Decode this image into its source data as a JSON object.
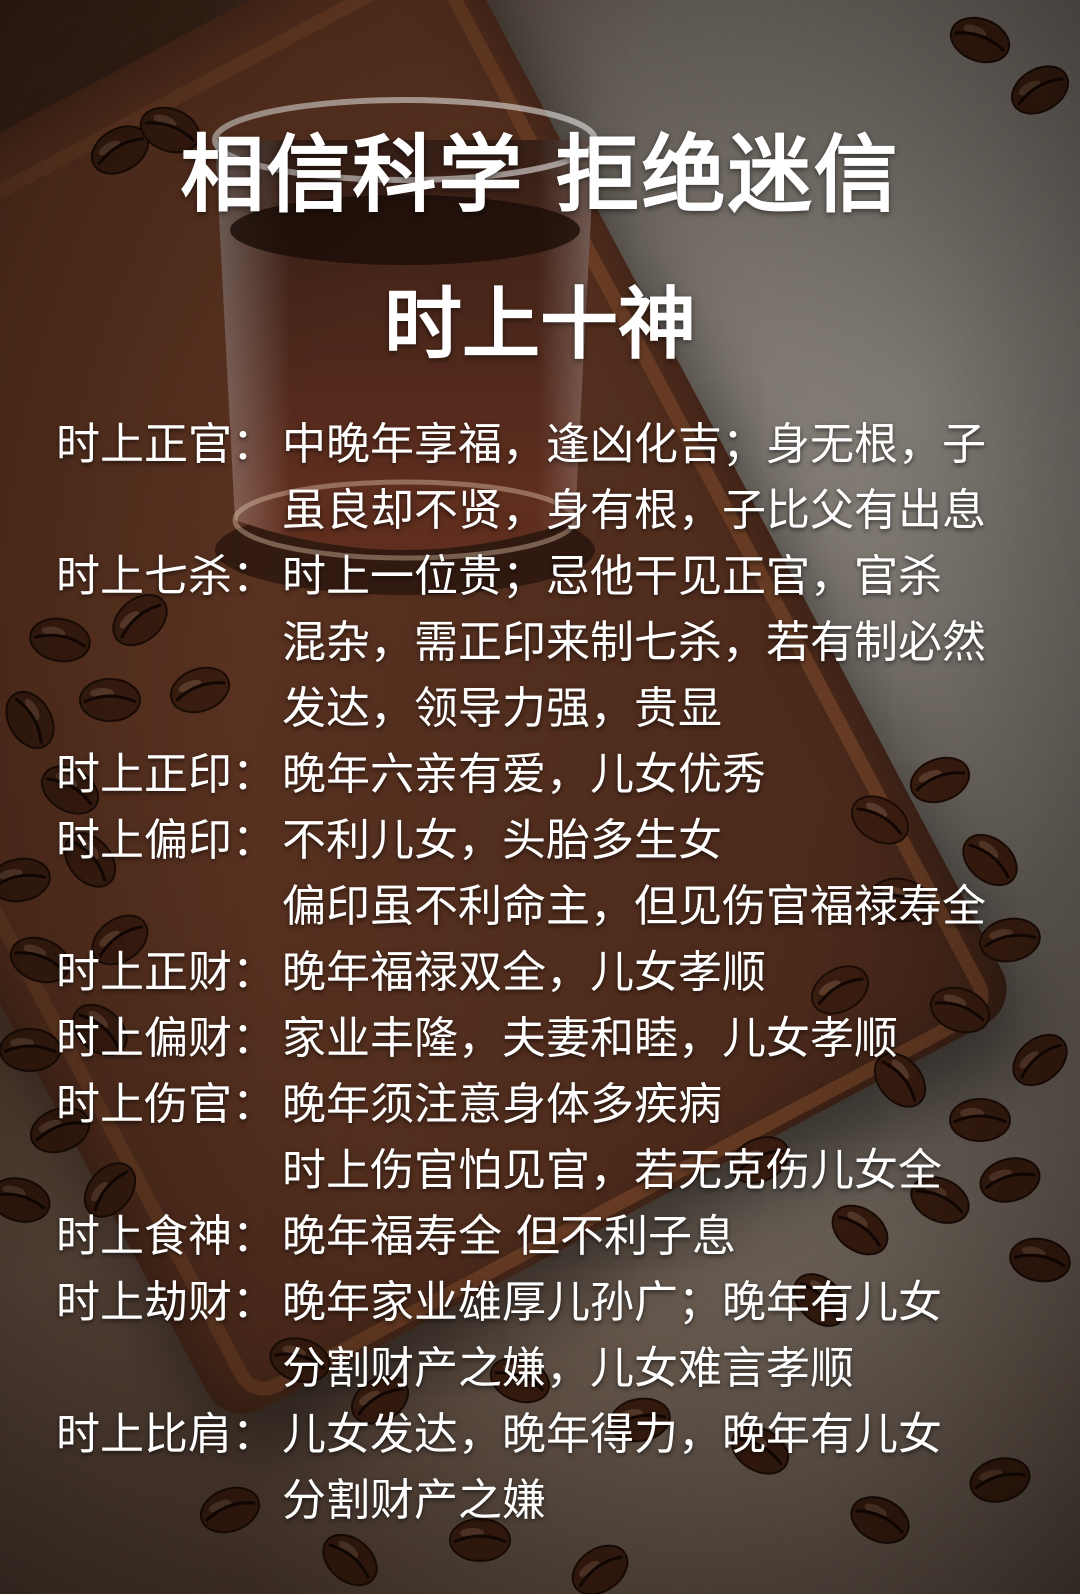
{
  "title": "相信科学 拒绝迷信",
  "subtitle": "时上十神",
  "entries": [
    {
      "label": "时上正官：",
      "lines": [
        "中晚年享福，逢凶化吉；身无根，子",
        "虽良却不贤，身有根，子比父有出息"
      ]
    },
    {
      "label": "时上七杀：",
      "lines": [
        "时上一位贵；忌他干见正官，官杀",
        "混杂，需正印来制七杀，若有制必然",
        "发达，领导力强，贵显"
      ]
    },
    {
      "label": "时上正印：",
      "lines": [
        "晚年六亲有爱，儿女优秀"
      ]
    },
    {
      "label": "时上偏印：",
      "lines": [
        "不利儿女，头胎多生女",
        "偏印虽不利命主，但见伤官福禄寿全"
      ]
    },
    {
      "label": "时上正财：",
      "lines": [
        "晚年福禄双全，儿女孝顺"
      ]
    },
    {
      "label": "时上偏财：",
      "lines": [
        "家业丰隆，夫妻和睦，儿女孝顺"
      ]
    },
    {
      "label": "时上伤官：",
      "lines": [
        "晚年须注意身体多疾病",
        "时上伤官怕见官，若无克伤儿女全"
      ]
    },
    {
      "label": "时上食神：",
      "lines": [
        "晚年福寿全 但不利子息"
      ]
    },
    {
      "label": "时上劫财：",
      "lines": [
        "晚年家业雄厚儿孙广；晚年有儿女",
        "分割财产之嫌，儿女难言孝顺"
      ]
    },
    {
      "label": "时上比肩：",
      "lines": [
        "儿女发达，晚年得力，晚年有儿女",
        "分割财产之嫌"
      ]
    }
  ]
}
